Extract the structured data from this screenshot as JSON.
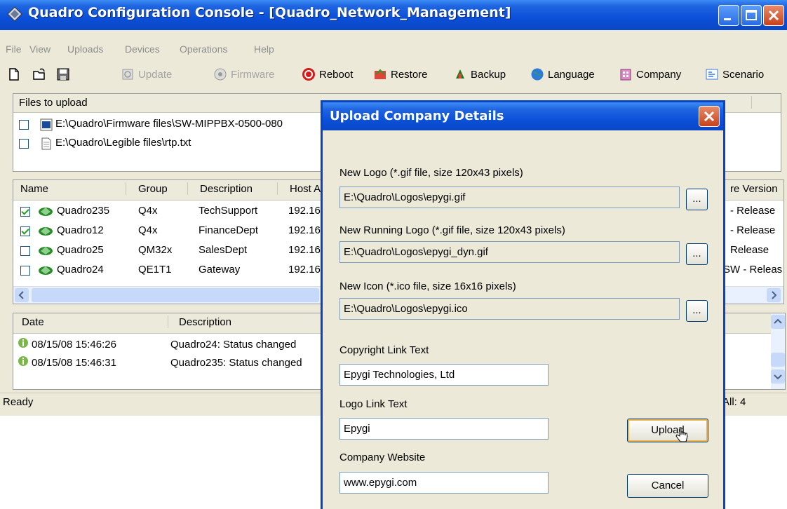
{
  "window": {
    "title": "Quadro Configuration Console - [Quadro_Network_Management]"
  },
  "menu": [
    "File",
    "View",
    "Uploads",
    "Devices",
    "Operations",
    "Help"
  ],
  "toolbar": {
    "update": "Update",
    "firmware": "Firmware",
    "reboot": "Reboot",
    "restore": "Restore",
    "backup": "Backup",
    "language": "Language",
    "company": "Company",
    "scenario": "Scenario"
  },
  "files": {
    "header": "Files to upload",
    "items": [
      "E:\\Quadro\\Firmware files\\SW-MIPPBX-0500-080",
      "E:\\Quadro\\Legible files\\rtp.txt"
    ]
  },
  "devices": {
    "columns": [
      "Name",
      "Group",
      "Description",
      "Host A",
      "re Version"
    ],
    "rows": [
      {
        "name": "Quadro235",
        "group": "Q4x",
        "desc": "TechSupport",
        "host": "192.16",
        "ver": "- Release",
        "checked": true
      },
      {
        "name": "Quadro12",
        "group": "Q4x",
        "desc": "FinanceDept",
        "host": "192.16",
        "ver": "- Release",
        "checked": true
      },
      {
        "name": "Quadro25",
        "group": "QM32x",
        "desc": "SalesDept",
        "host": "192.16",
        "ver": "Release",
        "checked": false
      },
      {
        "name": "Quadro24",
        "group": "QE1T1",
        "desc": "Gateway",
        "host": "192.16",
        "ver": "SW - Releas",
        "checked": false
      }
    ]
  },
  "log": {
    "columns": [
      "Date",
      "Description"
    ],
    "rows": [
      {
        "date": "08/15/08 15:46:26",
        "desc": "Quadro24: Status changed"
      },
      {
        "date": "08/15/08 15:46:31",
        "desc": "Quadro235: Status changed"
      }
    ]
  },
  "status": {
    "text": "Ready",
    "count": "All: 4"
  },
  "dialog": {
    "title": "Upload Company Details",
    "logo_label": "New Logo (*.gif file, size 120x43 pixels)",
    "logo_value": "E:\\Quadro\\Logos\\epygi.gif",
    "running_logo_label": "New Running Logo (*.gif file, size 120x43 pixels)",
    "running_logo_value": "E:\\Quadro\\Logos\\epygi_dyn.gif",
    "icon_label": "New Icon (*.ico file, size 16x16 pixels)",
    "icon_value": "E:\\Quadro\\Logos\\epygi.ico",
    "browse": "...",
    "copyright_label": "Copyright Link Text",
    "copyright_value": "Epygi Technologies, Ltd",
    "logo_link_label": "Logo Link Text",
    "logo_link_value": "Epygi",
    "website_label": "Company Website",
    "website_value": "www.epygi.com",
    "upload": "Upload",
    "cancel": "Cancel"
  }
}
